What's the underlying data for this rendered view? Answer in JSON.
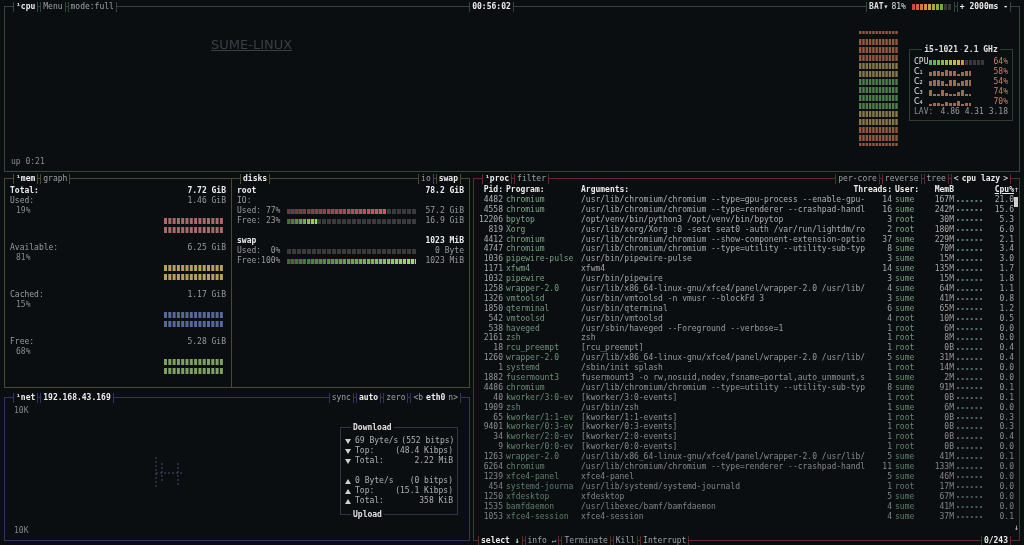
{
  "cpu_box": {
    "title": "¹cpu",
    "buttons": [
      "Menu",
      "mode:full"
    ],
    "clock": "00:56:02",
    "battery": {
      "label": "BAT▾",
      "percent": "81%",
      "level": 0.81
    },
    "refresh": "+ 2000ms -",
    "wallpaper_text": "SUME-LINUX",
    "uptime": "up 0:21",
    "info": {
      "model": "i5-1021",
      "freq": "2.1 GHz",
      "total": {
        "label": "CPU",
        "level": 0.64,
        "percent": "64%"
      },
      "cores": [
        {
          "label": "C₁",
          "percent": "58%"
        },
        {
          "label": "C₂",
          "percent": "54%"
        },
        {
          "label": "C₃",
          "percent": "74%"
        },
        {
          "label": "C₄",
          "percent": "70%"
        }
      ],
      "lav_label": "LAV:",
      "loads": "4.86 4.31 3.18"
    }
  },
  "mem": {
    "title": "¹mem",
    "buttons": [
      "graph"
    ],
    "total": {
      "label": "Total:",
      "value": "7.72 GiB"
    },
    "rows": [
      {
        "label": "Used:",
        "value": "1.46 GiB",
        "percent": "19%",
        "color": "#a86a6a"
      },
      {
        "label": "Available:",
        "value": "6.25 GiB",
        "percent": "81%",
        "color": "#b8a060"
      },
      {
        "label": "Cached:",
        "value": "1.17 GiB",
        "percent": "15%",
        "color": "#5a6898"
      },
      {
        "label": "Free:",
        "value": "5.28 GiB",
        "percent": "68%",
        "color": "#7fa060"
      }
    ]
  },
  "disks": {
    "title": "disks",
    "buttons": [
      "io",
      "swap"
    ],
    "root": {
      "name": "root",
      "size": "78.2 GiB",
      "io_label": "IO:",
      "meters": [
        {
          "label": "Used: 77%",
          "level": 0.77,
          "value": "57.2 GiB",
          "kind": "used"
        },
        {
          "label": "Free: 23%",
          "level": 0.23,
          "value": "16.9 GiB",
          "kind": "free"
        }
      ]
    },
    "swap": {
      "name": "swap",
      "size": "1023 MiB",
      "meters": [
        {
          "label": "Used:  0%",
          "level": 0,
          "value": "0 Byte",
          "kind": "used"
        },
        {
          "label": "Free:100%",
          "level": 1,
          "value": "1023 MiB",
          "kind": "free"
        }
      ]
    }
  },
  "net": {
    "title": "¹net",
    "address": "192.168.43.169",
    "buttons": [
      {
        "label": "sync",
        "selected": false
      },
      {
        "label": "auto",
        "selected": true
      },
      {
        "label": "zero",
        "selected": false
      }
    ],
    "interface": {
      "prev": "<b",
      "name": "eth0",
      "next": "n>"
    },
    "scale_top": "10K",
    "scale_bottom": "10K",
    "download": {
      "title": "Download",
      "rows": [
        {
          "kind": "down",
          "label": "69 Byte/s",
          "value": "(552 bitps)"
        },
        {
          "kind": "down",
          "label": "Top:",
          "value": "(48.4 Kibps)"
        },
        {
          "kind": "down",
          "label": "Total:",
          "value": "2.22 MiB"
        }
      ]
    },
    "upload": {
      "title": "Upload",
      "rows": [
        {
          "kind": "up",
          "label": "0 Byte/s",
          "value": "(0 bitps)"
        },
        {
          "kind": "up",
          "label": "Top:",
          "value": "(15.1 Kibps)"
        },
        {
          "kind": "up",
          "label": "Total:",
          "value": "358 KiB"
        }
      ]
    }
  },
  "proc": {
    "title": "¹proc",
    "filter": "filter",
    "options": [
      "per-core",
      "reverse",
      "tree"
    ],
    "sort": {
      "prev": "<",
      "label": "cpu lazy",
      "next": ">"
    },
    "columns": [
      "Pid:",
      "Program:",
      "Arguments:",
      "Threads:",
      "User:",
      "MemB",
      "Cpu%"
    ],
    "scroll_up": "↑",
    "scroll_down": "↓",
    "rows": [
      {
        "pid": "4482",
        "program": "chromium",
        "args": "/usr/lib/chromium/chromium --type=gpu-process --enable-gpu-",
        "threads": "14",
        "user": "sume",
        "mem": "167M",
        "cpu": "21.0"
      },
      {
        "pid": "4558",
        "program": "chromium",
        "args": "/usr/lib/chromium/chromium --type=renderer --crashpad-handl",
        "threads": "16",
        "user": "sume",
        "mem": "242M",
        "cpu": "15.6"
      },
      {
        "pid": "12206",
        "program": "bpytop",
        "args": "/opt/venv/bin/python3 /opt/venv/bin/bpytop",
        "threads": "3",
        "user": "root",
        "mem": "30M",
        "cpu": "5.3"
      },
      {
        "pid": "819",
        "program": "Xorg",
        "args": "/usr/lib/xorg/Xorg :0 -seat seat0 -auth /var/run/lightdm/ro",
        "threads": "2",
        "user": "root",
        "mem": "180M",
        "cpu": "6.0"
      },
      {
        "pid": "4412",
        "program": "chromium",
        "args": "/usr/lib/chromium/chromium --show-component-extension-optio",
        "threads": "37",
        "user": "sume",
        "mem": "229M",
        "cpu": "2.1"
      },
      {
        "pid": "4747",
        "program": "chromium",
        "args": "/usr/lib/chromium/chromium --type=utility --utility-sub-typ",
        "threads": "8",
        "user": "sume",
        "mem": "70M",
        "cpu": "3.4"
      },
      {
        "pid": "1036",
        "program": "pipewire-pulse",
        "args": "/usr/bin/pipewire-pulse",
        "threads": "3",
        "user": "sume",
        "mem": "15M",
        "cpu": "3.0"
      },
      {
        "pid": "1171",
        "program": "xfwm4",
        "args": "xfwm4",
        "threads": "14",
        "user": "sume",
        "mem": "135M",
        "cpu": "1.7"
      },
      {
        "pid": "1032",
        "program": "pipewire",
        "args": "/usr/bin/pipewire",
        "threads": "3",
        "user": "sume",
        "mem": "15M",
        "cpu": "1.8"
      },
      {
        "pid": "1258",
        "program": "wrapper-2.0",
        "args": "/usr/lib/x86_64-linux-gnu/xfce4/panel/wrapper-2.0 /usr/lib/",
        "threads": "4",
        "user": "sume",
        "mem": "64M",
        "cpu": "1.1"
      },
      {
        "pid": "1326",
        "program": "vmtoolsd",
        "args": "/usr/bin/vmtoolsd -n vmusr --blockFd 3",
        "threads": "3",
        "user": "sume",
        "mem": "41M",
        "cpu": "0.8"
      },
      {
        "pid": "1850",
        "program": "qterminal",
        "args": "/usr/bin/qterminal",
        "threads": "6",
        "user": "sume",
        "mem": "65M",
        "cpu": "1.2"
      },
      {
        "pid": "542",
        "program": "vmtoolsd",
        "args": "/usr/bin/vmtoolsd",
        "threads": "4",
        "user": "root",
        "mem": "10M",
        "cpu": "0.5"
      },
      {
        "pid": "538",
        "program": "haveged",
        "args": "/usr/sbin/haveged --Foreground --verbose=1",
        "threads": "1",
        "user": "root",
        "mem": "6M",
        "cpu": "0.0"
      },
      {
        "pid": "2161",
        "program": "zsh",
        "args": "zsh",
        "threads": "1",
        "user": "root",
        "mem": "8M",
        "cpu": "0.0"
      },
      {
        "pid": "18",
        "program": "rcu_preempt",
        "args": "[rcu_preempt]",
        "threads": "1",
        "user": "root",
        "mem": "0B",
        "cpu": "0.4"
      },
      {
        "pid": "1260",
        "program": "wrapper-2.0",
        "args": "/usr/lib/x86_64-linux-gnu/xfce4/panel/wrapper-2.0 /usr/lib/",
        "threads": "5",
        "user": "sume",
        "mem": "31M",
        "cpu": "0.4"
      },
      {
        "pid": "1",
        "program": "systemd",
        "args": "/sbin/init splash",
        "threads": "1",
        "user": "root",
        "mem": "14M",
        "cpu": "0.0"
      },
      {
        "pid": "1882",
        "program": "fusermount3",
        "args": "fusermount3 -o rw,nosuid,nodev,fsname=portal,auto_unmount,s",
        "threads": "1",
        "user": "sume",
        "mem": "2M",
        "cpu": "0.0"
      },
      {
        "pid": "4486",
        "program": "chromium",
        "args": "/usr/lib/chromium/chromium --type=utility --utility-sub-typ",
        "threads": "8",
        "user": "sume",
        "mem": "91M",
        "cpu": "0.1"
      },
      {
        "pid": "40",
        "program": "kworker/3:0-ev",
        "args": "[kworker/3:0-events]",
        "threads": "1",
        "user": "root",
        "mem": "0B",
        "cpu": "0.1"
      },
      {
        "pid": "1909",
        "program": "zsh",
        "args": "/usr/bin/zsh",
        "threads": "1",
        "user": "sume",
        "mem": "6M",
        "cpu": "0.0"
      },
      {
        "pid": "65",
        "program": "kworker/1:1-ev",
        "args": "[kworker/1:1-events]",
        "threads": "1",
        "user": "root",
        "mem": "0B",
        "cpu": "0.3"
      },
      {
        "pid": "9401",
        "program": "kworker/0:3-ev",
        "args": "[kworker/0:3-events]",
        "threads": "1",
        "user": "root",
        "mem": "0B",
        "cpu": "0.3"
      },
      {
        "pid": "34",
        "program": "kworker/2:0-ev",
        "args": "[kworker/2:0-events]",
        "threads": "1",
        "user": "root",
        "mem": "0B",
        "cpu": "0.4"
      },
      {
        "pid": "9",
        "program": "kworker/0:0-ev",
        "args": "[kworker/0:0-events]",
        "threads": "1",
        "user": "root",
        "mem": "0B",
        "cpu": "0.0"
      },
      {
        "pid": "1263",
        "program": "wrapper-2.0",
        "args": "/usr/lib/x86_64-linux-gnu/xfce4/panel/wrapper-2.0 /usr/lib/",
        "threads": "5",
        "user": "sume",
        "mem": "41M",
        "cpu": "0.1"
      },
      {
        "pid": "6264",
        "program": "chromium",
        "args": "/usr/lib/chromium/chromium --type=renderer --crashpad-handl",
        "threads": "11",
        "user": "sume",
        "mem": "133M",
        "cpu": "0.0"
      },
      {
        "pid": "1239",
        "program": "xfce4-panel",
        "args": "xfce4-panel",
        "threads": "5",
        "user": "sume",
        "mem": "46M",
        "cpu": "0.0"
      },
      {
        "pid": "454",
        "program": "systemd-journa",
        "args": "/usr/lib/systemd/systemd-journald",
        "threads": "1",
        "user": "root",
        "mem": "17M",
        "cpu": "0.0"
      },
      {
        "pid": "1250",
        "program": "xfdesktop",
        "args": "xfdesktop",
        "threads": "5",
        "user": "sume",
        "mem": "67M",
        "cpu": "0.0"
      },
      {
        "pid": "1535",
        "program": "bamfdaemon",
        "args": "/usr/libexec/bamf/bamfdaemon",
        "threads": "4",
        "user": "sume",
        "mem": "41M",
        "cpu": "0.0"
      },
      {
        "pid": "1053",
        "program": "xfce4-session",
        "args": "xfce4-session",
        "threads": "4",
        "user": "sume",
        "mem": "37M",
        "cpu": "0.1"
      }
    ],
    "footer": {
      "buttons": [
        "select ↓",
        "info ↵",
        "Terminate",
        "Kill",
        "Interrupt"
      ],
      "count": "0/243"
    }
  }
}
